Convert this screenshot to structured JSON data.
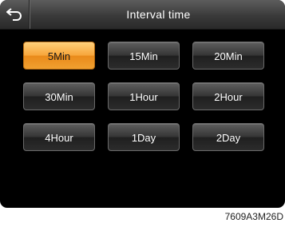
{
  "header": {
    "title": "Interval time",
    "back_icon": "back-arrow-icon"
  },
  "options": [
    {
      "label": "5Min",
      "selected": true
    },
    {
      "label": "15Min",
      "selected": false
    },
    {
      "label": "20Min",
      "selected": false
    },
    {
      "label": "30Min",
      "selected": false
    },
    {
      "label": "1Hour",
      "selected": false
    },
    {
      "label": "2Hour",
      "selected": false
    },
    {
      "label": "4Hour",
      "selected": false
    },
    {
      "label": "1Day",
      "selected": false
    },
    {
      "label": "2Day",
      "selected": false
    }
  ],
  "colors": {
    "accent": "#f7a53a",
    "background": "#000000"
  },
  "figure_code": "7609A3M26D"
}
